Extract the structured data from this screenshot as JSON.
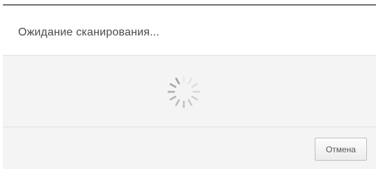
{
  "dialog": {
    "title": "Ожидание сканирования...",
    "status_icon": "loading-spinner-icon",
    "cancel_label": "Отмена"
  },
  "colors": {
    "header_bg": "#ffffff",
    "body_bg": "#f4f4f4",
    "title_text": "#4a4a4a",
    "spinner": "#9a9a9a"
  }
}
